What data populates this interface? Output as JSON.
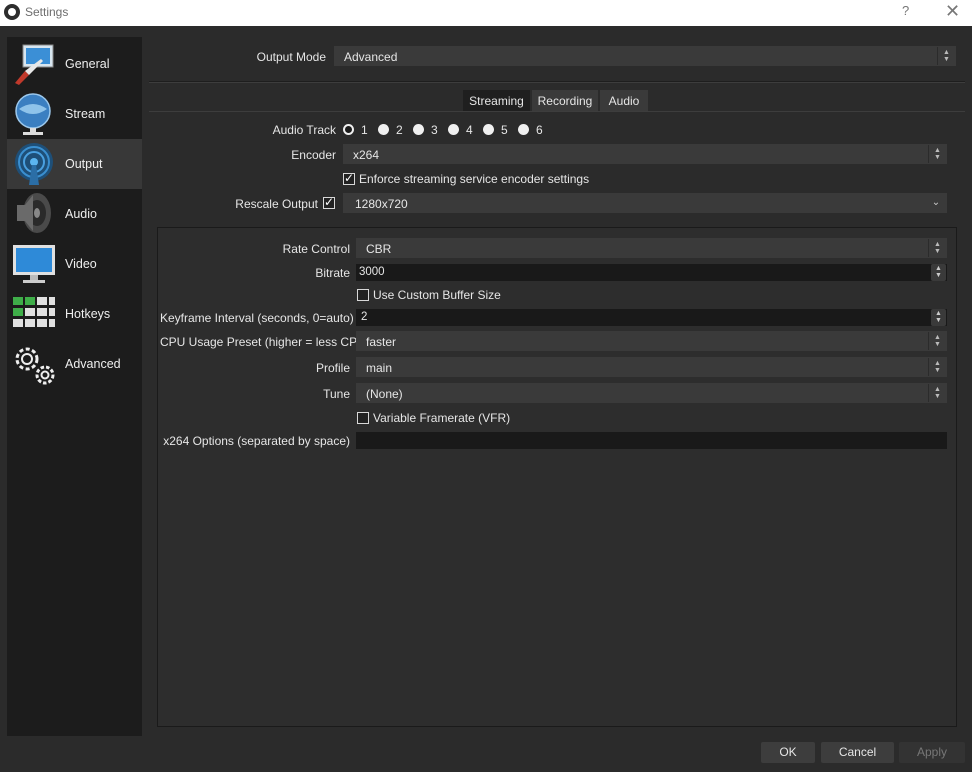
{
  "window": {
    "title": "Settings",
    "help": "?",
    "close": "✕"
  },
  "sidebar": {
    "items": [
      {
        "label": "General",
        "icon": "general-icon"
      },
      {
        "label": "Stream",
        "icon": "stream-icon"
      },
      {
        "label": "Output",
        "icon": "output-icon",
        "active": true
      },
      {
        "label": "Audio",
        "icon": "audio-icon"
      },
      {
        "label": "Video",
        "icon": "video-icon"
      },
      {
        "label": "Hotkeys",
        "icon": "hotkeys-icon"
      },
      {
        "label": "Advanced",
        "icon": "advanced-icon"
      }
    ]
  },
  "output_mode": {
    "label": "Output Mode",
    "value": "Advanced"
  },
  "tabs": [
    "Streaming",
    "Recording",
    "Audio"
  ],
  "active_tab": "Streaming",
  "audio_track": {
    "label": "Audio Track",
    "options": [
      "1",
      "2",
      "3",
      "4",
      "5",
      "6"
    ],
    "selected": "1"
  },
  "encoder": {
    "label": "Encoder",
    "value": "x264"
  },
  "enforce": {
    "label": "Enforce streaming service encoder settings",
    "checked": true
  },
  "rescale": {
    "label": "Rescale Output",
    "checked": true,
    "value": "1280x720"
  },
  "encoder_settings": {
    "rate_control": {
      "label": "Rate Control",
      "value": "CBR"
    },
    "bitrate": {
      "label": "Bitrate",
      "value": "3000"
    },
    "custom_buffer": {
      "label": "Use Custom Buffer Size",
      "checked": false
    },
    "keyframe": {
      "label": "Keyframe Interval (seconds, 0=auto)",
      "value": "2"
    },
    "cpu_preset": {
      "label": "CPU Usage Preset (higher = less CPU)",
      "value": "faster"
    },
    "profile": {
      "label": "Profile",
      "value": "main"
    },
    "tune": {
      "label": "Tune",
      "value": "(None)"
    },
    "vfr": {
      "label": "Variable Framerate (VFR)",
      "checked": false
    },
    "x264_options": {
      "label": "x264 Options (separated by space)",
      "value": ""
    }
  },
  "buttons": {
    "ok": "OK",
    "cancel": "Cancel",
    "apply": "Apply"
  },
  "colors": {
    "background": "#2b2b2b",
    "sidebar": "#1c1c1c",
    "input": "#3a3a3a",
    "accent_blue": "#2f7fc1"
  }
}
